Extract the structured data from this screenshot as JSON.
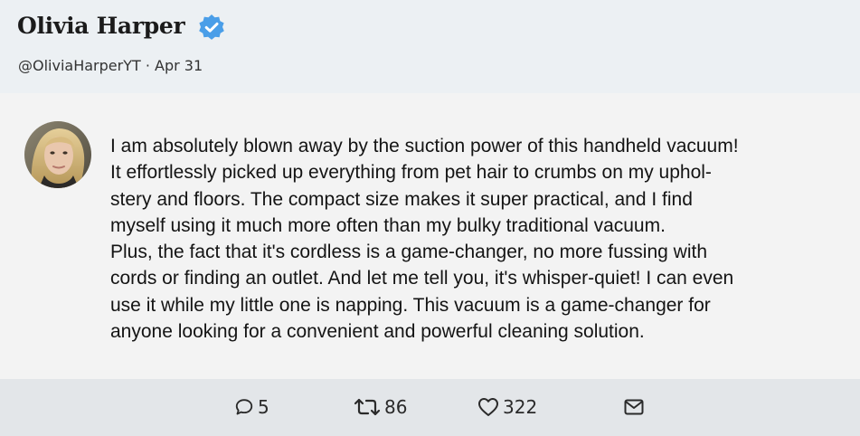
{
  "author": {
    "name": "Olivia Harper",
    "handle": "@OliviaHarperYT",
    "separator": "·",
    "date": "Apr 31",
    "verified": true,
    "badge_color": "#4a9ee8"
  },
  "tweet": {
    "text": "I am absolutely blown away by the suction power of this handheld vacuum!\nIt effortlessly picked up everything from pet hair to crumbs on my uphol-\nstery and floors. The compact size makes it super practical, and I find\nmyself using it much more often than my bulky traditional vacuum.\nPlus, the fact that it's cordless is a game-changer, no more fussing with\ncords or finding an outlet. And let me tell you, it's whisper-quiet! I can even\nuse it while my little one is napping. This vacuum is a game-changer for\nanyone looking for a convenient and powerful cleaning solution."
  },
  "actions": {
    "reply_count": "5",
    "retweet_count": "86",
    "like_count": "322",
    "icons": [
      "comment-icon",
      "retweet-icon",
      "heart-icon",
      "mail-icon"
    ]
  },
  "colors": {
    "header_bg": "#ecf0f3",
    "body_bg": "#f3f3f3",
    "footer_bg": "#e3e6e9"
  }
}
